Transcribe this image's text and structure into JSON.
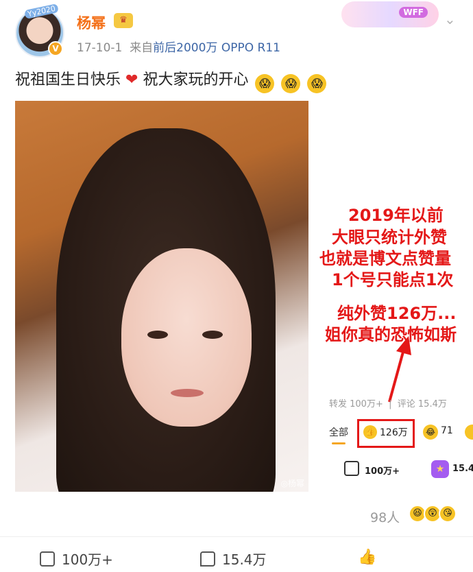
{
  "header": {
    "avatar_tag": "Yy2020",
    "username": "杨幂",
    "crown_icon": "crown-icon",
    "verified_badge": "V",
    "date": "17-10-1",
    "source_prefix": "来自",
    "source": "前后2000万 OPPO R11",
    "decor_label": "WFF"
  },
  "post": {
    "text_a": "祝祖国生日快乐",
    "text_b": "祝大家玩的开心",
    "photo_watermark": "◎杨幂"
  },
  "annotation": {
    "line1": "2019年以前",
    "line2": "大眼只统计外赞",
    "line3": "也就是博文点赞量",
    "line4": "1个号只能点1次",
    "line5": "纯外赞126万...",
    "line6": "姐你真的恐怖如斯"
  },
  "stats": {
    "repost_label": "转发 100万+",
    "comment_label": "评论 15.4万",
    "tab_all": "全部",
    "like_count": "126万",
    "laugh_count": "71",
    "share_count": "100万+",
    "star_count": "15.4"
  },
  "viewers": {
    "count": "98人"
  },
  "actions": {
    "share": "100万+",
    "comment": "15.4万"
  },
  "colors": {
    "username": "#f4711a",
    "source": "#3d66a6",
    "annotation": "#e41818",
    "accent": "#f5a623"
  }
}
